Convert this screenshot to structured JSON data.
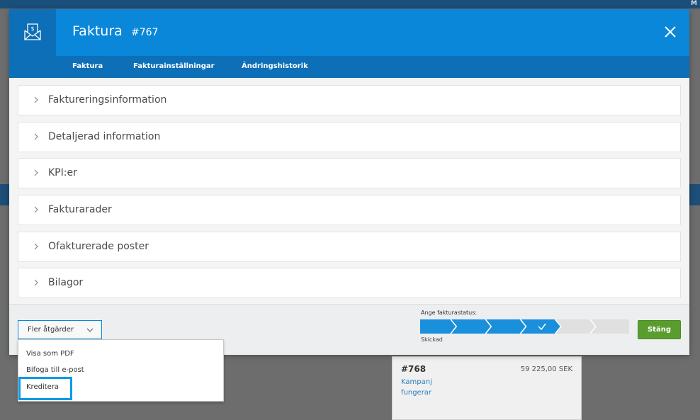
{
  "background": {
    "topbar_letter": "M",
    "card": {
      "number": "#768",
      "amount": "59 225,00 SEK",
      "line1": "Kampanj",
      "line2": "fungerar"
    }
  },
  "modal": {
    "title": "Faktura",
    "number": "#767",
    "icon": "invoice-envelope-icon",
    "tabs": [
      {
        "label": "Faktura",
        "active": true
      },
      {
        "label": "Fakturainställningar",
        "active": false
      },
      {
        "label": "Ändringshistorik",
        "active": false
      }
    ],
    "sections": [
      {
        "label": "Faktureringsinformation"
      },
      {
        "label": "Detaljerad information"
      },
      {
        "label": "KPI:er"
      },
      {
        "label": "Fakturarader"
      },
      {
        "label": "Ofakturerade poster"
      },
      {
        "label": "Bilagor"
      }
    ],
    "footer": {
      "more_actions_label": "Fler åtgärder",
      "status_label": "Ange fakturastatus:",
      "status_caption": "Skickad",
      "status_steps_total": 6,
      "status_steps_completed": 4,
      "close_label": "Stäng"
    },
    "dropdown": {
      "items": [
        {
          "label": "Visa som PDF"
        },
        {
          "label": "Bifoga till e-post"
        },
        {
          "label": "Kreditera",
          "highlighted": true
        }
      ]
    }
  },
  "colors": {
    "header_blue": "#0a87d9",
    "tab_blue": "#0c6fb7",
    "status_blue": "#1a8fdc",
    "status_grey": "#e0e0e0",
    "close_green": "#5a9d2f",
    "highlight_border": "#0a9ae6"
  }
}
